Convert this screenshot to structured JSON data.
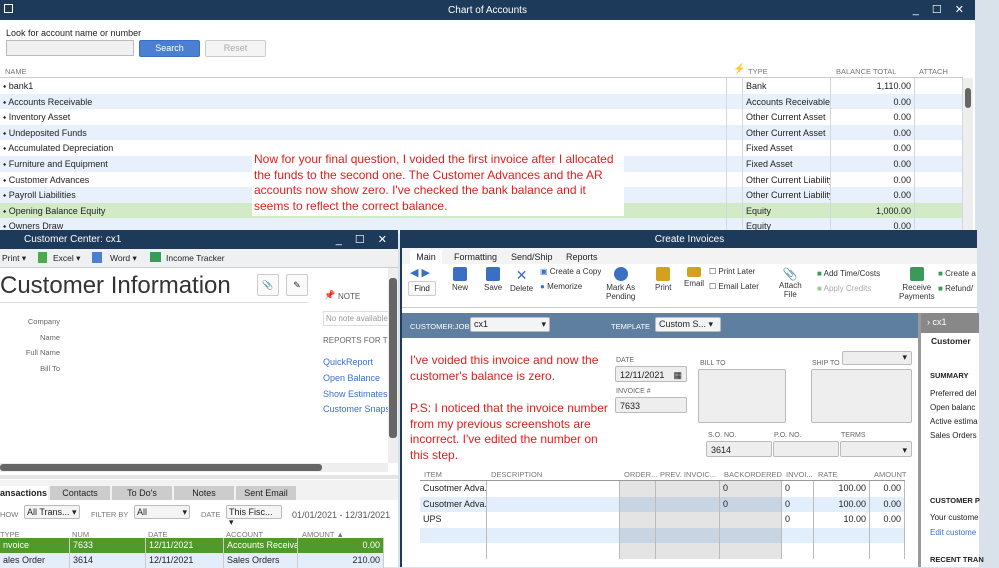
{
  "coa": {
    "title": "Chart of Accounts",
    "search_label": "Look for account name or number",
    "search_value": "",
    "search_btn": "Search",
    "reset_btn": "Reset",
    "headers": [
      "NAME",
      "TYPE",
      "BALANCE TOTAL",
      "ATTACH"
    ],
    "rows": [
      {
        "name": "bank1",
        "type": "Bank",
        "balance": "1,110.00"
      },
      {
        "name": "Accounts Receivable",
        "type": "Accounts Receivable",
        "balance": "0.00"
      },
      {
        "name": "Inventory Asset",
        "type": "Other Current Asset",
        "balance": "0.00"
      },
      {
        "name": "Undeposited Funds",
        "type": "Other Current Asset",
        "balance": "0.00"
      },
      {
        "name": "Accumulated Depreciation",
        "type": "Fixed Asset",
        "balance": "0.00"
      },
      {
        "name": "Furniture and Equipment",
        "type": "Fixed Asset",
        "balance": "0.00"
      },
      {
        "name": "Customer Advances",
        "type": "Other Current Liability",
        "balance": "0.00"
      },
      {
        "name": "Payroll Liabilities",
        "type": "Other Current Liability",
        "balance": "0.00"
      },
      {
        "name": "Opening Balance Equity",
        "type": "Equity",
        "balance": "1,000.00"
      },
      {
        "name": "Owners Draw",
        "type": "Equity",
        "balance": "0.00"
      }
    ],
    "note": "Now for your final question, I voided the first invoice after I allocated the funds to the second one. The Customer Advances and the AR accounts now show zero. I've checked the bank balance and it seems to reflect the correct balance."
  },
  "cc": {
    "title": "Customer Center: cx1",
    "toolbar": [
      "Print",
      "Excel",
      "Word",
      "Income Tracker"
    ],
    "heading": "Customer Information",
    "fields": [
      "Company Name",
      "Full Name",
      "Bill To"
    ],
    "note_label": "NOTE",
    "note_placeholder": "No note available",
    "reports_label": "REPORTS FOR T",
    "links": [
      "QuickReport",
      "Open Balance",
      "Show Estimates",
      "Customer Snapsh"
    ],
    "tabs": [
      "ansactions",
      "Contacts",
      "To Do's",
      "Notes",
      "Sent Email"
    ],
    "filters": {
      "show_label": "HOW",
      "show": "All Trans...",
      "filter_label": "FILTER BY",
      "filter": "All",
      "date_label": "DATE",
      "date": "This Fisc...",
      "range": "01/01/2021 - 12/31/2021"
    },
    "headers": [
      "TYPE",
      "NUM",
      "DATE",
      "ACCOUNT",
      "AMOUNT"
    ],
    "rows": [
      {
        "type": "nvoice",
        "num": "7633",
        "date": "12/11/2021",
        "account": "Accounts Receiva...",
        "amount": "0.00"
      },
      {
        "type": "ales Order",
        "num": "3614",
        "date": "12/11/2021",
        "account": "Sales Orders",
        "amount": "210.00"
      }
    ]
  },
  "inv": {
    "title": "Create Invoices",
    "tabs": [
      "Main",
      "Formatting",
      "Send/Ship",
      "Reports"
    ],
    "toolbar": {
      "find": "Find",
      "new": "New",
      "save": "Save",
      "delete": "Delete",
      "copy": "Create a Copy",
      "memorize": "Memorize",
      "pending1": "Mark As",
      "pending2": "Pending",
      "print": "Print",
      "email": "Email",
      "print_later": "Print Later",
      "email_later": "Email Later",
      "attach1": "Attach",
      "attach2": "File",
      "time": "Add Time/Costs",
      "credits": "Apply Credits",
      "receive1": "Receive",
      "receive2": "Payments",
      "create": "Create a",
      "refund": "Refund/"
    },
    "customer_label": "CUSTOMER:JOB",
    "customer": "cx1",
    "template_label": "TEMPLATE",
    "template": "Custom S...",
    "date_label": "DATE",
    "date": "12/11/2021",
    "invno_label": "INVOICE #",
    "invno": "7633",
    "bill_to": "BILL TO",
    "ship_to": "SHIP TO",
    "so_label": "S.O. NO.",
    "so": "3614",
    "po_label": "P.O. NO.",
    "terms_label": "TERMS",
    "headers": [
      "ITEM",
      "DESCRIPTION",
      "ORDER...",
      "PREV. INVOIC...",
      "BACKORDERED",
      "INVOI...",
      "RATE",
      "AMOUNT"
    ],
    "rows": [
      {
        "item": "Cusotmer Adva...",
        "back": "0",
        "invoiced": "0",
        "rate": "100.00",
        "amount": "0.00"
      },
      {
        "item": "Cusotmer Adva...",
        "back": "0",
        "invoiced": "0",
        "rate": "100.00",
        "amount": "0.00"
      },
      {
        "item": "UPS",
        "back": "",
        "invoiced": "0",
        "rate": "10.00",
        "amount": "0.00"
      }
    ],
    "note1": "I've voided this invoice and now the customer's balance is zero.",
    "note2": "P.S: I noticed that the invoice number from my previous screenshots are incorrect. I've edited the number on this step.",
    "panel": {
      "name": "cx1",
      "tab": "Customer",
      "summary": "SUMMARY",
      "items": [
        "Preferred del",
        "Open balanc",
        "Active estima",
        "Sales Orders"
      ],
      "cp": "CUSTOMER P",
      "cp_text": "Your custome",
      "edit": "Edit custome",
      "recent": "RECENT TRAN"
    }
  }
}
